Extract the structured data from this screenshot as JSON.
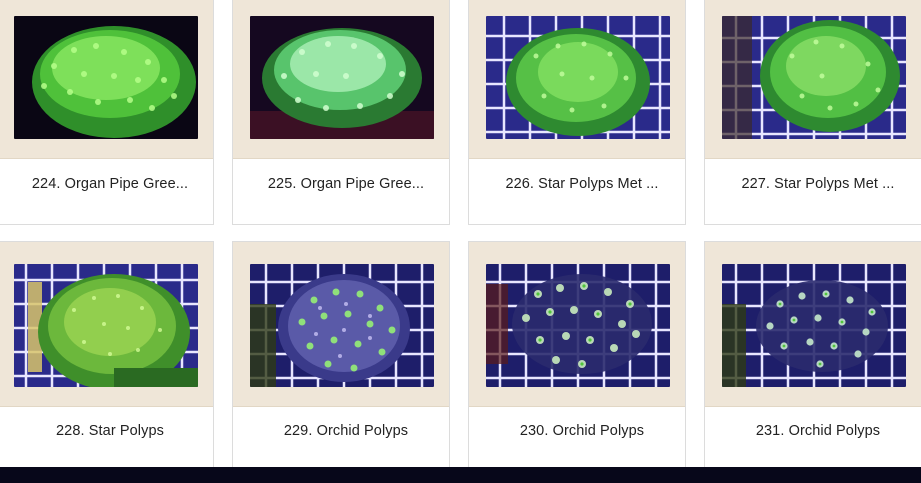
{
  "grid": {
    "items": [
      {
        "label": "224. Organ Pipe Gree...",
        "theme": "green-dark"
      },
      {
        "label": "225. Organ Pipe Gree...",
        "theme": "green-dark"
      },
      {
        "label": "226. Star Polyps Met ...",
        "theme": "green-grid"
      },
      {
        "label": "227. Star Polyps Met ...",
        "theme": "green-grid"
      },
      {
        "label": "228. Star Polyps",
        "theme": "green-grid"
      },
      {
        "label": "229. Orchid Polyps",
        "theme": "orchid"
      },
      {
        "label": "230. Orchid Polyps",
        "theme": "orchid"
      },
      {
        "label": "231. Orchid Polyps",
        "theme": "orchid"
      }
    ]
  },
  "colors": {
    "frame": "#efe6d8",
    "caption_text": "#222222",
    "bottom_bar": "#07071a"
  }
}
